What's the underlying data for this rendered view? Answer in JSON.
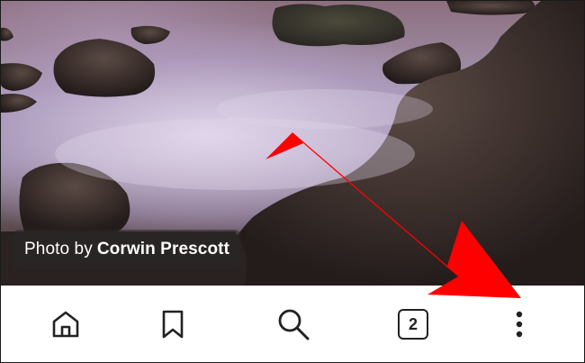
{
  "photo": {
    "caption_prefix": "Photo by",
    "caption_author": "Corwin Prescott"
  },
  "bottom_nav": {
    "items": [
      {
        "icon": "home-icon"
      },
      {
        "icon": "bookmark-icon"
      },
      {
        "icon": "search-icon"
      },
      {
        "icon": "tabs-count-icon",
        "count": "2"
      },
      {
        "icon": "more-vertical-icon"
      }
    ]
  },
  "annotation": {
    "arrow_color": "#ff0000"
  }
}
